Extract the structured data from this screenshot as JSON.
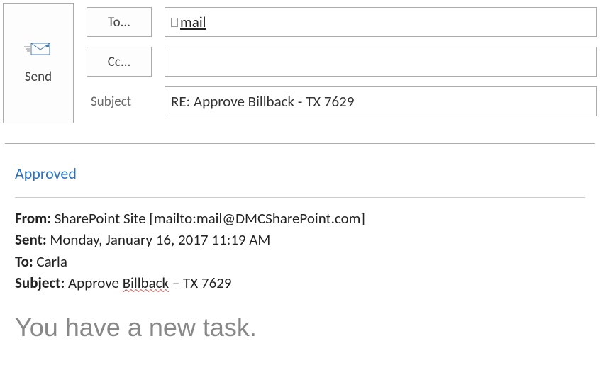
{
  "header": {
    "send_label": "Send",
    "to_label": "To...",
    "cc_label": "Cc...",
    "subject_label": "Subject",
    "to_value": "mail",
    "cc_value": "",
    "subject_value": "RE: Approve Billback - TX 7629"
  },
  "body": {
    "reply_text": "Approved",
    "from_label": "From:",
    "from_value": "SharePoint Site  [mailto:mail@DMCSharePoint.com]",
    "sent_label": "Sent:",
    "sent_value": "Monday, January 16, 2017 11:19 AM",
    "to_label": "To:",
    "to_value": "Carla",
    "subject_label": "Subject:",
    "subject_prefix": "Approve ",
    "subject_squiggle": "Billback",
    "subject_suffix": " – TX 7629",
    "task_heading": "You have a new task."
  }
}
